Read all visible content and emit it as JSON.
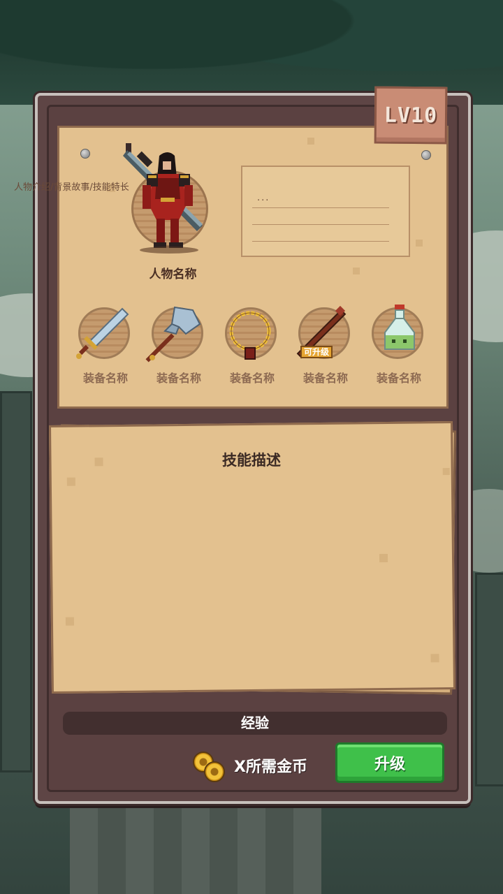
{
  "level": {
    "label": "LV10"
  },
  "character": {
    "name": "人物名称",
    "description": "人物介绍/背景故事/技能特长",
    "description_more": "..."
  },
  "equipment": [
    {
      "label": "装备名称",
      "icon": "sword-icon"
    },
    {
      "label": "装备名称",
      "icon": "battle-axe-icon"
    },
    {
      "label": "装备名称",
      "icon": "necklace-icon"
    },
    {
      "label": "装备名称",
      "icon": "staff-icon",
      "badge": "可升级"
    },
    {
      "label": "装备名称",
      "icon": "potion-icon"
    }
  ],
  "skill": {
    "title": "技能描述"
  },
  "experience": {
    "label": "经验",
    "progress": 0
  },
  "cost": {
    "label": "X所需金币",
    "icon": "gold-coins-icon"
  },
  "upgrade_button": {
    "label": "升级"
  },
  "colors": {
    "parchment": "#e3c18f",
    "frame": "#5e4545",
    "button": "#3fc04a",
    "tag": "#c98c75"
  }
}
